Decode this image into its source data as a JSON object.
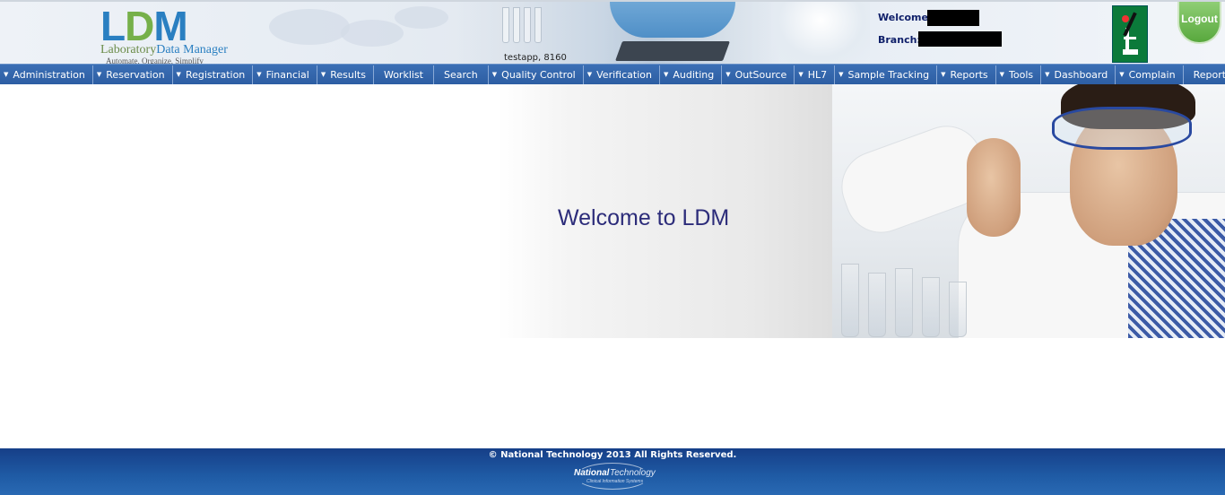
{
  "header": {
    "logo": {
      "brand": "LDM",
      "name_part1": "Laboratory",
      "name_part2": "Data Manager",
      "tagline": "Automate, Organize, Simplify"
    },
    "server_info": "testapp, 8160",
    "welcome_label": "Welcome:",
    "branch_label": "Branch:",
    "logout_label": "Logout"
  },
  "menu": {
    "items": [
      {
        "label": "Administration",
        "dropdown": true
      },
      {
        "label": "Reservation",
        "dropdown": true
      },
      {
        "label": "Registration",
        "dropdown": true
      },
      {
        "label": "Financial",
        "dropdown": true
      },
      {
        "label": "Results",
        "dropdown": true
      },
      {
        "label": "Worklist",
        "dropdown": false
      },
      {
        "label": "Search",
        "dropdown": false
      },
      {
        "label": "Quality Control",
        "dropdown": true
      },
      {
        "label": "Verification",
        "dropdown": true
      },
      {
        "label": "Auditing",
        "dropdown": true
      },
      {
        "label": "OutSource",
        "dropdown": true
      },
      {
        "label": "HL7",
        "dropdown": true
      },
      {
        "label": "Sample Tracking",
        "dropdown": true
      },
      {
        "label": "Reports",
        "dropdown": true
      },
      {
        "label": "Tools",
        "dropdown": true
      },
      {
        "label": "Dashboard",
        "dropdown": true
      },
      {
        "label": "Complain",
        "dropdown": true
      },
      {
        "label": "Reporting Tool",
        "dropdown": false
      }
    ]
  },
  "main": {
    "welcome_text": "Welcome to LDM"
  },
  "footer": {
    "copyright": "© National Technology 2013 All Rights Reserved.",
    "logo_part1": "National",
    "logo_part2": "Technology",
    "logo_tagline": "Clinical Information Systems"
  },
  "colors": {
    "menu_bar": "#2d5ea3",
    "footer": "#1f5ba5",
    "welcome_text": "#2c2c7a",
    "logout": "#58a83d"
  }
}
